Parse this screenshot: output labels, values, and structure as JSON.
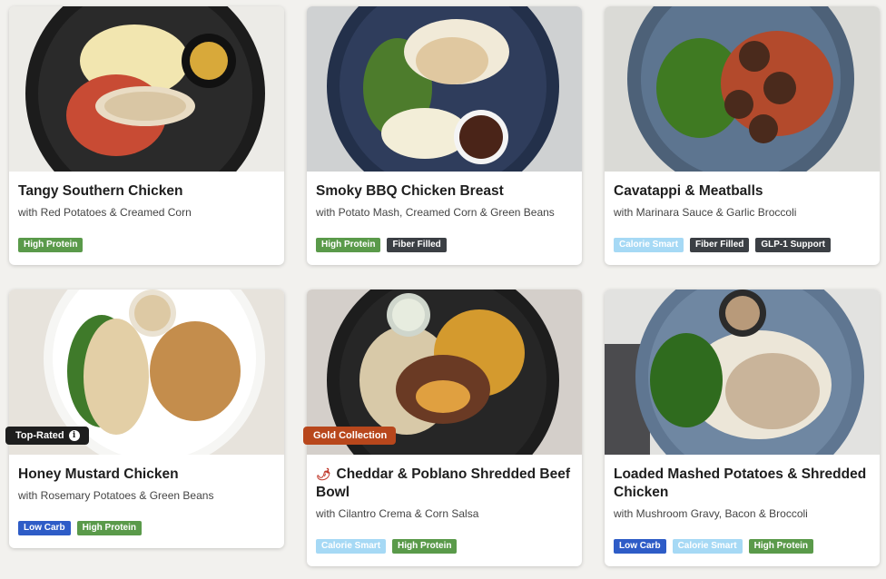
{
  "cards": [
    {
      "title": "Tangy Southern Chicken",
      "subtitle": "with Red Potatoes & Creamed Corn",
      "tags": [
        "High Protein"
      ]
    },
    {
      "title": "Smoky BBQ Chicken Breast",
      "subtitle": "with Potato Mash, Creamed Corn & Green Beans",
      "tags": [
        "High Protein",
        "Fiber Filled"
      ]
    },
    {
      "title": "Cavatappi & Meatballs",
      "subtitle": "with Marinara Sauce & Garlic Broccoli",
      "tags": [
        "Calorie Smart",
        "Fiber Filled",
        "GLP-1 Support"
      ]
    },
    {
      "title": "Honey Mustard Chicken",
      "subtitle": "with Rosemary Potatoes & Green Beans",
      "tags": [
        "Low Carb",
        "High Protein"
      ],
      "ribbon": "Top-Rated",
      "ribbon_icon": "info-icon"
    },
    {
      "title": "Cheddar & Poblano Shredded Beef Bowl",
      "subtitle": "with Cilantro Crema & Corn Salsa",
      "tags": [
        "Calorie Smart",
        "High Protein"
      ],
      "ribbon": "Gold Collection",
      "title_icon": "chili-pepper-icon"
    },
    {
      "title": "Loaded Mashed Potatoes & Shredded Chicken",
      "subtitle": "with Mushroom Gravy, Bacon & Broccoli",
      "tags": [
        "Low Carb",
        "Calorie Smart",
        "High Protein"
      ]
    }
  ],
  "colors": {
    "high_protein": "#5a9a4a",
    "fiber_filled": "#3b3f44",
    "calorie_smart": "#a6d9f5",
    "glp1_support": "#3b3f44",
    "low_carb": "#2e5cc7",
    "top_rated": "#1e1e1e",
    "gold_collection": "#b8471c"
  }
}
